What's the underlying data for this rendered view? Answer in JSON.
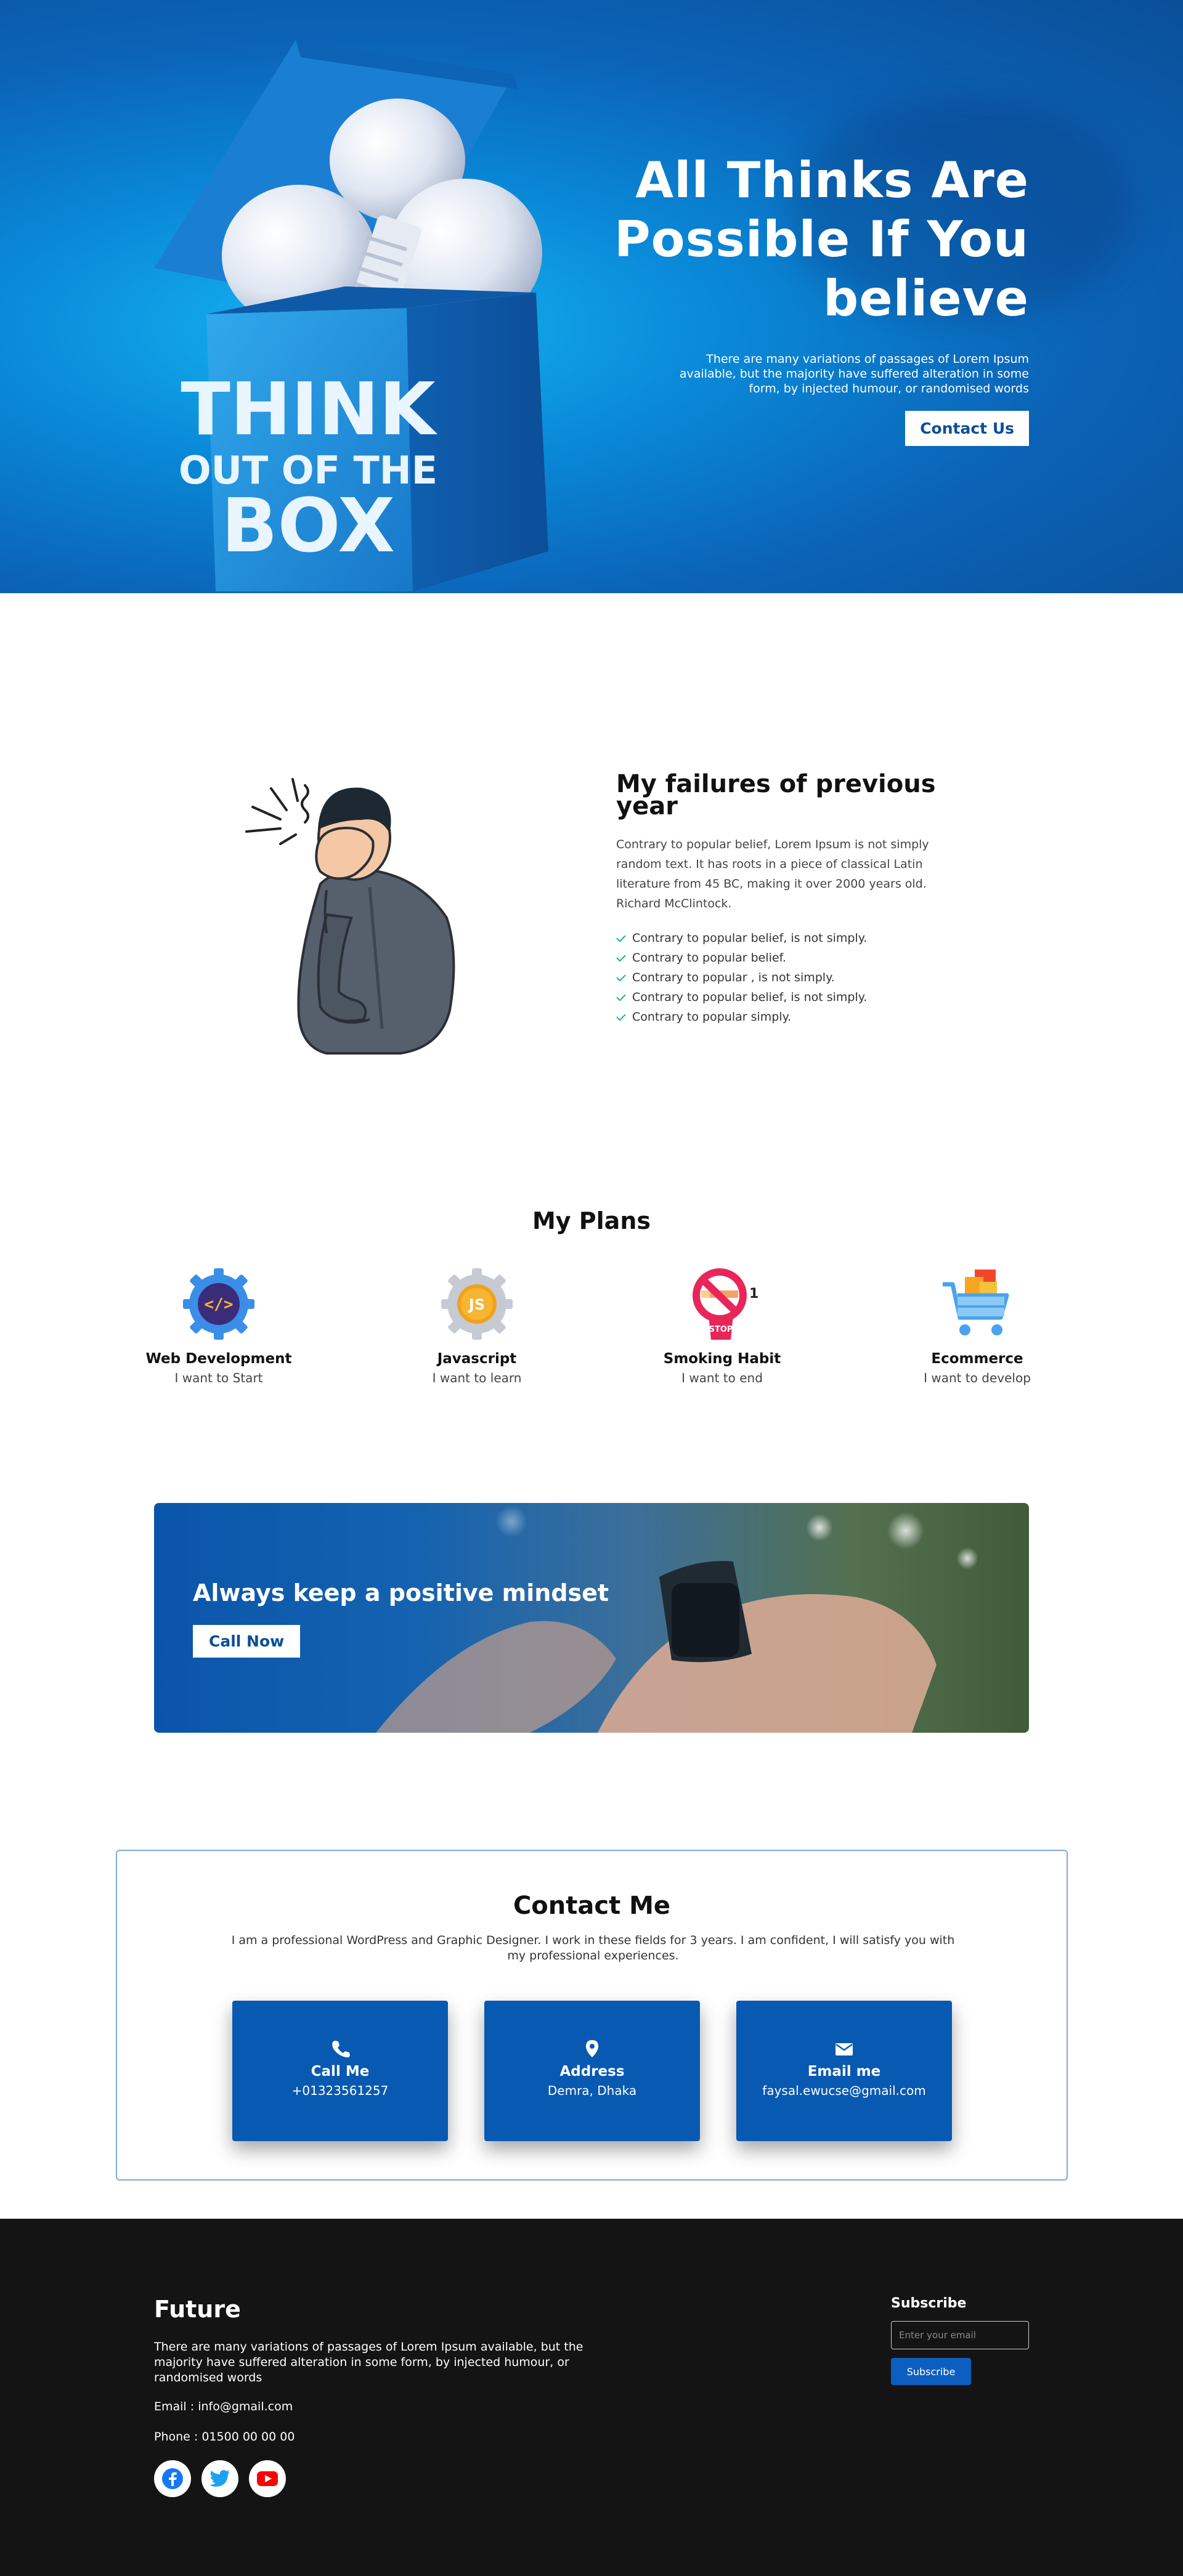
{
  "hero": {
    "box_text": [
      "THINK",
      "OUT OF THE",
      "BOX"
    ],
    "title_lines": [
      "All Thinks Are",
      "Possible If You",
      "believe"
    ],
    "text": "There are many variations of passages of Lorem Ipsum available, but the majority have suffered alteration in some form, by injected humour, or randomised words",
    "button": "Contact Us"
  },
  "failures": {
    "title": "My failures of previous year",
    "paragraph": "Contrary to popular belief, Lorem Ipsum is not simply random text. It has roots in a piece of classical Latin literature from 45 BC, making it over 2000 years old. Richard McClintock.",
    "items": [
      "Contrary to popular belief, is not simply.",
      "Contrary to popular belief.",
      "Contrary to popular , is not simply.",
      "Contrary to popular belief, is not simply.",
      "Contrary to popular simply."
    ],
    "check_color": "#19b394"
  },
  "plans": {
    "title": "My Plans",
    "items": [
      {
        "name": "Web Development",
        "sub": "I want to Start",
        "icon": "code-gear-icon"
      },
      {
        "name": "Javascript",
        "sub": "I want to learn",
        "icon": "js-gear-icon"
      },
      {
        "name": "Smoking Habit",
        "sub": "I want to end",
        "icon": "no-smoking-icon",
        "icon_text": "STOP",
        "badge": "1"
      },
      {
        "name": "Ecommerce",
        "sub": "I want to develop",
        "icon": "shopping-cart-icon"
      }
    ]
  },
  "banner": {
    "title": "Always keep a positive mindset",
    "button": "Call Now"
  },
  "contact": {
    "title": "Contact Me",
    "text": "I am a professional WordPress and Graphic Designer. I work in these fields for 3 years. I am confident, I will satisfy you with my professional experiences.",
    "cards": [
      {
        "label": "Call Me",
        "value": "+01323561257",
        "icon": "phone-icon"
      },
      {
        "label": "Address",
        "value": "Demra, Dhaka",
        "icon": "location-pin-icon"
      },
      {
        "label": "Email me",
        "value": "faysal.ewucse@gmail.com",
        "icon": "envelope-icon"
      }
    ]
  },
  "footer": {
    "brand": "Future",
    "text": "There are many variations of passages of Lorem Ipsum available, but the majority have suffered alteration in some form, by injected humour, or randomised words",
    "email": "Email : info@gmail.com",
    "phone": "Phone : 01500 00 00 00",
    "social": [
      "facebook-icon",
      "twitter-icon",
      "youtube-icon"
    ],
    "subscribe_title": "Subscribe",
    "subscribe_placeholder": "Enter your email",
    "subscribe_button": "Subscribe"
  },
  "colors": {
    "primary_blue": "#0859b2",
    "footer_bg": "#141414",
    "facebook": "#1877f2",
    "twitter": "#1da1f2",
    "youtube": "#ff0000"
  }
}
